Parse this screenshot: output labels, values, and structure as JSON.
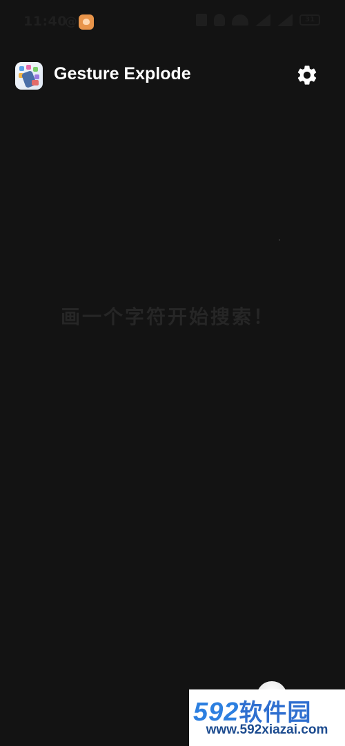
{
  "status_bar": {
    "time": "11:40",
    "at_symbol": "@",
    "battery": "31",
    "icons": [
      "nfc-icon",
      "bell-icon",
      "wifi-icon",
      "signal-icon",
      "signal-icon",
      "battery-icon"
    ]
  },
  "header": {
    "title": "Gesture Explode",
    "icon": "app-logo",
    "settings_icon": "gear-icon"
  },
  "canvas": {
    "hint": "画一个字符开始搜索！"
  },
  "watermark": {
    "logo_number": "592",
    "logo_text": "软件园",
    "url": "www.592xiazai.com"
  },
  "colors": {
    "background": "#131313",
    "title": "#ffffff",
    "hint": "#262626",
    "watermark_blue": "#2c7fe0"
  }
}
